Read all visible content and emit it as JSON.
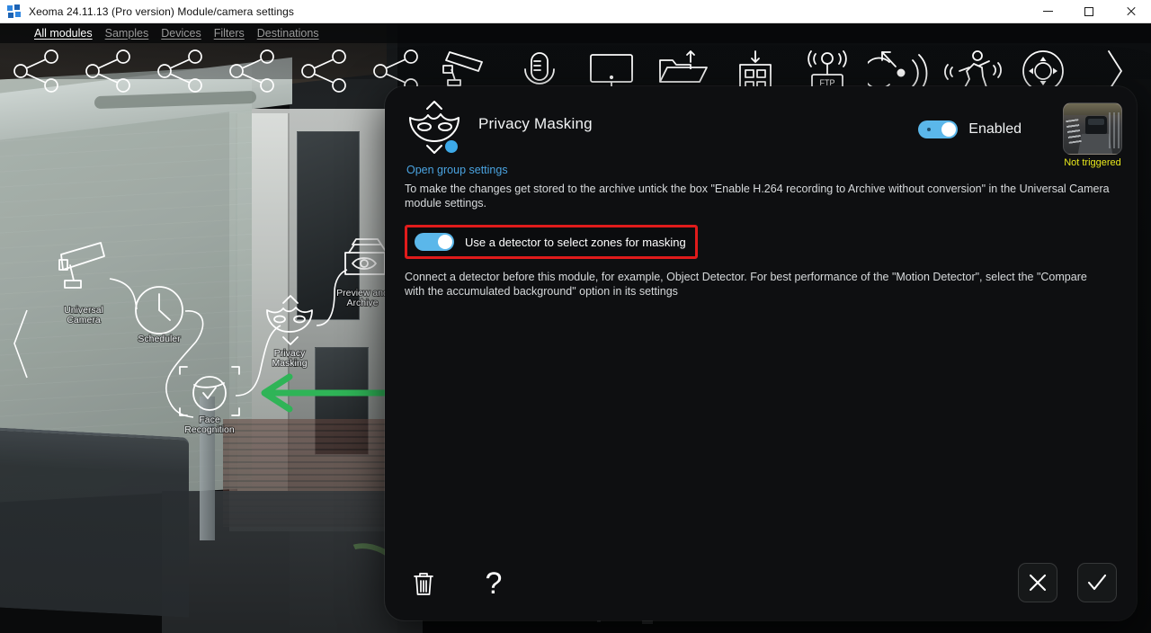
{
  "window": {
    "title": "Xeoma 24.11.13 (Pro version) Module/camera settings",
    "app_icon": "xeoma-logo-icon",
    "minimize": "minimize-icon",
    "maximize": "maximize-icon",
    "close": "close-icon"
  },
  "tabs": [
    {
      "label": "All modules",
      "active": true
    },
    {
      "label": "Samples",
      "active": false
    },
    {
      "label": "Devices",
      "active": false
    },
    {
      "label": "Filters",
      "active": false
    },
    {
      "label": "Destinations",
      "active": false
    }
  ],
  "toolbar_icons": [
    "module-chain-icon-1",
    "module-chain-icon-2",
    "module-chain-icon-3",
    "module-chain-icon-4",
    "module-chain-icon-5",
    "module-chain-icon-6",
    "universal-camera-icon",
    "microphone-icon",
    "screen-capture-icon",
    "folder-upload-icon",
    "building-download-icon",
    "ftp-receiver-icon",
    "motion-detector-icon",
    "running-person-icon",
    "ptz-control-icon",
    "next-page-chevron-icon"
  ],
  "chain": {
    "nodes": [
      {
        "name": "Universal Camera",
        "label_line1": "Universal",
        "label_line2": "Camera"
      },
      {
        "name": "Scheduler",
        "label_line1": "Scheduler",
        "label_line2": ""
      },
      {
        "name": "Face Recognition",
        "label_line1": "Face",
        "label_line2": "Recognition"
      },
      {
        "name": "Privacy Masking",
        "label_line1": "Privacy",
        "label_line2": "Masking"
      },
      {
        "name": "Preview and Archive",
        "label_line1": "Preview and",
        "label_line2": "Archive"
      }
    ]
  },
  "annotations": {
    "left_arrow": "green-left-arrow",
    "right_arrow": "green-right-arrow",
    "color": "#2fb457"
  },
  "dialog": {
    "module_icon": "privacy-masking-mask-icon",
    "title": "Privacy Masking",
    "group_settings_link": "Open group settings",
    "enabled_label": "Enabled",
    "enabled_state": true,
    "preview": {
      "caption": "Not triggered",
      "caption_color": "#e8e81c"
    },
    "description": "To make the changes get stored to the archive untick the box \"Enable H.264 recording to Archive without conversion\" in the Universal Camera module settings.",
    "option": {
      "label": "Use a detector to select zones for masking",
      "enabled": true,
      "highlight_color": "#e01b1b"
    },
    "hint": "Connect a detector before this module, for example, Object Detector. For best performance of the \"Motion Detector\", select the \"Compare with the accumulated background\" option in its settings",
    "footer": {
      "delete": "trash-icon",
      "help": "?",
      "cancel": "cancel-x-icon",
      "confirm": "confirm-check-icon"
    }
  },
  "colors": {
    "accent_blue": "#5bb7ea",
    "link_blue": "#4aa3e0",
    "dialog_bg": "#0e0f11",
    "highlight_red": "#e01b1b",
    "arrow_green": "#2fb457",
    "status_yellow": "#e8e81c"
  }
}
